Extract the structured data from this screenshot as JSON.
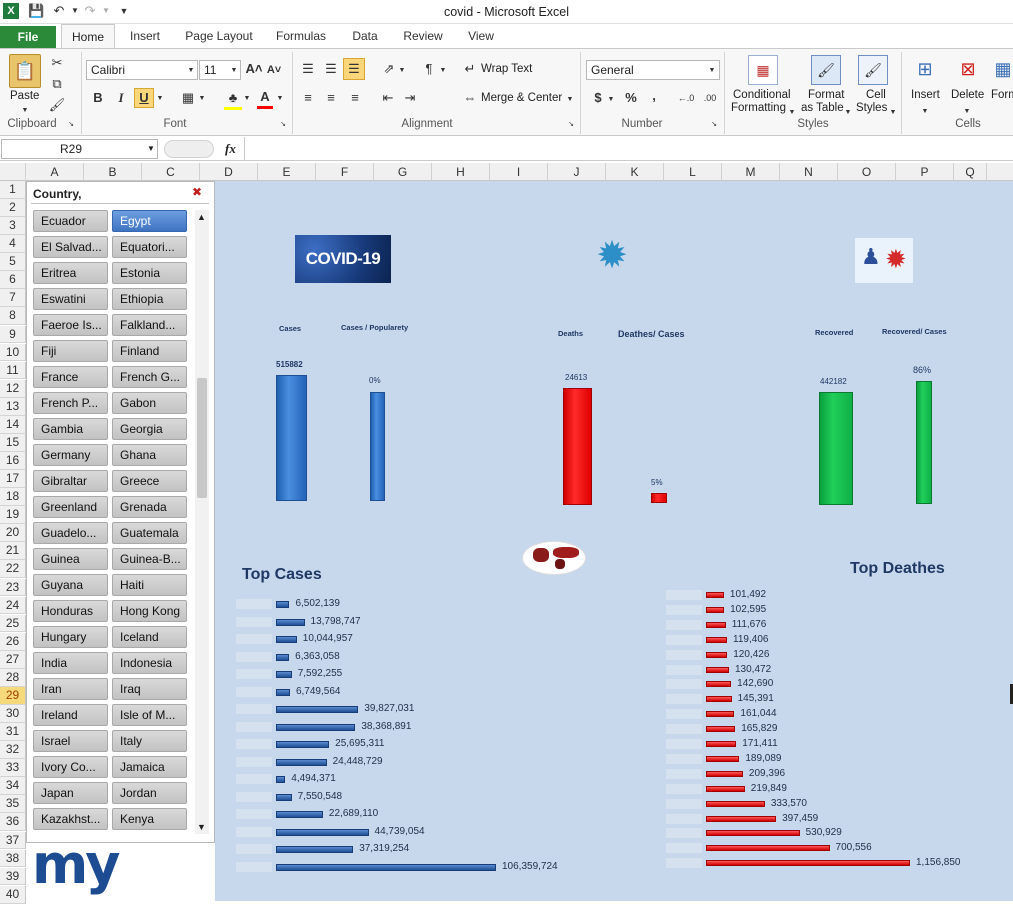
{
  "window": {
    "title": "covid  -  Microsoft Excel"
  },
  "tabs": [
    "File",
    "Home",
    "Insert",
    "Page Layout",
    "Formulas",
    "Data",
    "Review",
    "View"
  ],
  "ribbon": {
    "clipboard": {
      "label": "Clipboard",
      "paste": "Paste"
    },
    "font": {
      "label": "Font",
      "name": "Calibri",
      "size": "11"
    },
    "alignment": {
      "label": "Alignment",
      "wrap": "Wrap Text",
      "merge": "Merge & Center"
    },
    "number": {
      "label": "Number",
      "format": "General",
      "currency": "$",
      "percent": "%",
      "comma": ","
    },
    "styles": {
      "label": "Styles",
      "conditional_1": "Conditional",
      "conditional_2": "Formatting",
      "format_table_1": "Format",
      "format_table_2": "as Table",
      "cell_styles_1": "Cell",
      "cell_styles_2": "Styles"
    },
    "cells": {
      "label": "Cells",
      "insert": "Insert",
      "delete": "Delete",
      "format": "Form"
    }
  },
  "formula_bar": {
    "name_box": "R29",
    "fx": "fx",
    "value": ""
  },
  "columns": [
    "A",
    "B",
    "C",
    "D",
    "E",
    "F",
    "G",
    "H",
    "I",
    "J",
    "K",
    "L",
    "M",
    "N",
    "O",
    "P",
    "Q"
  ],
  "rows": [
    "1",
    "2",
    "3",
    "4",
    "5",
    "6",
    "7",
    "8",
    "9",
    "10",
    "11",
    "12",
    "13",
    "14",
    "15",
    "16",
    "17",
    "18",
    "19",
    "20",
    "21",
    "22",
    "23",
    "24",
    "25",
    "26",
    "27",
    "28",
    "29",
    "30",
    "31",
    "32",
    "33",
    "34",
    "35",
    "36",
    "37",
    "38",
    "39",
    "40"
  ],
  "slicer": {
    "header": "Country,",
    "items": [
      [
        "Ecuador",
        "Egypt"
      ],
      [
        "El Salvad...",
        "Equatori..."
      ],
      [
        "Eritrea",
        "Estonia"
      ],
      [
        "Eswatini",
        "Ethiopia"
      ],
      [
        "Faeroe Is...",
        "Falkland..."
      ],
      [
        "Fiji",
        "Finland"
      ],
      [
        "France",
        "French G..."
      ],
      [
        "French P...",
        "Gabon"
      ],
      [
        "Gambia",
        "Georgia"
      ],
      [
        "Germany",
        "Ghana"
      ],
      [
        "Gibraltar",
        "Greece"
      ],
      [
        "Greenland",
        "Grenada"
      ],
      [
        "Guadelo...",
        "Guatemala"
      ],
      [
        "Guinea",
        "Guinea-B..."
      ],
      [
        "Guyana",
        "Haiti"
      ],
      [
        "Honduras",
        "Hong Kong"
      ],
      [
        "Hungary",
        "Iceland"
      ],
      [
        "India",
        "Indonesia"
      ],
      [
        "Iran",
        "Iraq"
      ],
      [
        "Ireland",
        "Isle of M..."
      ],
      [
        "Israel",
        "Italy"
      ],
      [
        "Ivory Co...",
        "Jamaica"
      ],
      [
        "Japan",
        "Jordan"
      ],
      [
        "Kazakhst...",
        "Kenya"
      ]
    ],
    "selected": "Egypt"
  },
  "logo": {
    "text": "my"
  },
  "dashboard": {
    "covid_badge": "COVID-19",
    "cases_title": "Cases",
    "cases_pop_title": "Cases  /  Popularety",
    "deaths_title": "Deaths",
    "deaths_cases_title": "Deathes/  Cases",
    "recovered_title": "Recovered",
    "recovered_cases_title": "Recovered/  Cases",
    "cases_value": "515882",
    "cases_pop_value": "0%",
    "deaths_value": "24613",
    "deaths_cases_value": "5%",
    "recovered_value": "442182",
    "recovered_cases_value": "86%",
    "top_cases_title": "Top Cases",
    "top_deaths_title": "Top Deathes"
  },
  "chart_data": [
    {
      "type": "bar",
      "title": "Cases",
      "values": [
        515882
      ],
      "colors": [
        "#2e75c9"
      ]
    },
    {
      "type": "bar",
      "title": "Cases  /  Popularety",
      "values": [
        0
      ],
      "unit": "%"
    },
    {
      "type": "bar",
      "title": "Deaths",
      "values": [
        24613
      ],
      "colors": [
        "#e00000"
      ]
    },
    {
      "type": "bar",
      "title": "Deathes/  Cases",
      "values": [
        5
      ],
      "unit": "%"
    },
    {
      "type": "bar",
      "title": "Recovered",
      "values": [
        442182
      ],
      "colors": [
        "#13b24a"
      ]
    },
    {
      "type": "bar",
      "title": "Recovered/  Cases",
      "values": [
        86
      ],
      "unit": "%"
    },
    {
      "type": "bar",
      "orientation": "horizontal",
      "title": "Top Cases",
      "value_labels": [
        "6,502,139",
        "13,798,747",
        "10,044,957",
        "6,363,058",
        "7,592,255",
        "6,749,564",
        "39,827,031",
        "38,368,891",
        "25,695,311",
        "24,448,729",
        "4,494,371",
        "7,550,548",
        "22,689,110",
        "44,739,054",
        "37,319,254",
        "106,359,724"
      ],
      "values": [
        6502139,
        13798747,
        10044957,
        6363058,
        7592255,
        6749564,
        39827031,
        38368891,
        25695311,
        24448729,
        4494371,
        7550548,
        22689110,
        44739054,
        37319254,
        106359724
      ],
      "color": "#2f5f9e"
    },
    {
      "type": "bar",
      "orientation": "horizontal",
      "title": "Top Deathes",
      "value_labels": [
        "101,492",
        "102,595",
        "111,676",
        "119,406",
        "120,426",
        "130,472",
        "142,690",
        "145,391",
        "161,044",
        "165,829",
        "171,411",
        "189,089",
        "209,396",
        "219,849",
        "333,570",
        "397,459",
        "530,929",
        "700,556",
        "1,156,850"
      ],
      "values": [
        101492,
        102595,
        111676,
        119406,
        120426,
        130472,
        142690,
        145391,
        161044,
        165829,
        171411,
        189089,
        209396,
        219849,
        333570,
        397459,
        530929,
        700556,
        1156850
      ],
      "color": "#e01818"
    }
  ]
}
